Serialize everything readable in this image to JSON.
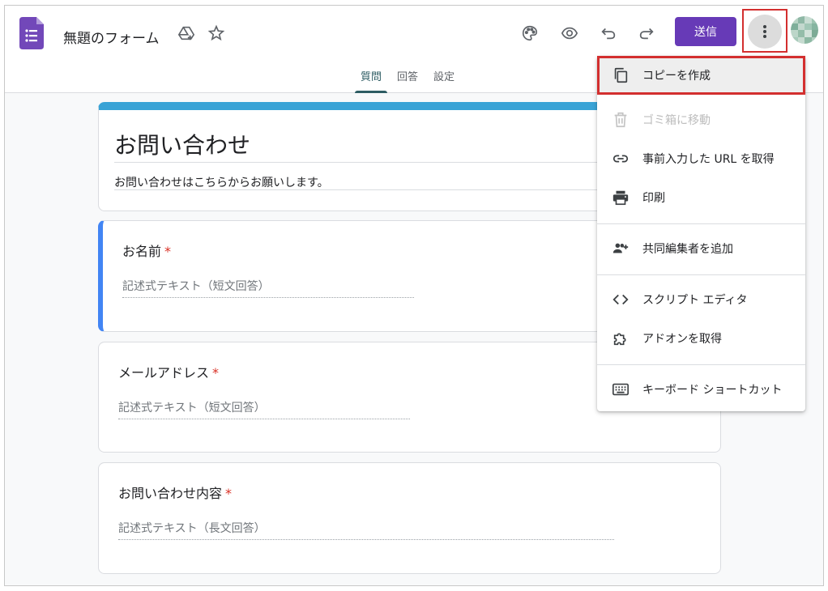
{
  "header": {
    "doc_title": "無題のフォーム",
    "send_label": "送信"
  },
  "tabs": [
    {
      "label": "質問",
      "active": true
    },
    {
      "label": "回答",
      "active": false
    },
    {
      "label": "設定",
      "active": false
    }
  ],
  "form": {
    "title": "お問い合わせ",
    "description": "お問い合わせはこちらからお願いします。",
    "questions": [
      {
        "label": "お名前",
        "required_mark": "*",
        "hint": "記述式テキスト（短文回答）"
      },
      {
        "label": "メールアドレス",
        "required_mark": "*",
        "hint": "記述式テキスト（短文回答）"
      },
      {
        "label": "お問い合わせ内容",
        "required_mark": "*",
        "hint": "記述式テキスト（長文回答）"
      }
    ]
  },
  "menu": {
    "items": [
      {
        "label": "コピーを作成",
        "icon": "copy-icon",
        "highlighted": true
      },
      {
        "label": "ゴミ箱に移動",
        "icon": "trash-icon",
        "disabled": true
      },
      {
        "label": "事前入力した URL を取得",
        "icon": "link-icon"
      },
      {
        "label": "印刷",
        "icon": "print-icon"
      },
      {
        "label": "共同編集者を追加",
        "icon": "add-people-icon"
      },
      {
        "label": "スクリプト エディタ",
        "icon": "code-icon"
      },
      {
        "label": "アドオンを取得",
        "icon": "puzzle-icon"
      },
      {
        "label": "キーボード ショートカット",
        "icon": "keyboard-icon"
      }
    ]
  },
  "colors": {
    "brand_purple": "#673ab7",
    "accent_blue": "#4285f4",
    "title_bar_blue": "#39a3d6",
    "highlight_red": "#d32f2f",
    "required_red": "#d93025"
  }
}
